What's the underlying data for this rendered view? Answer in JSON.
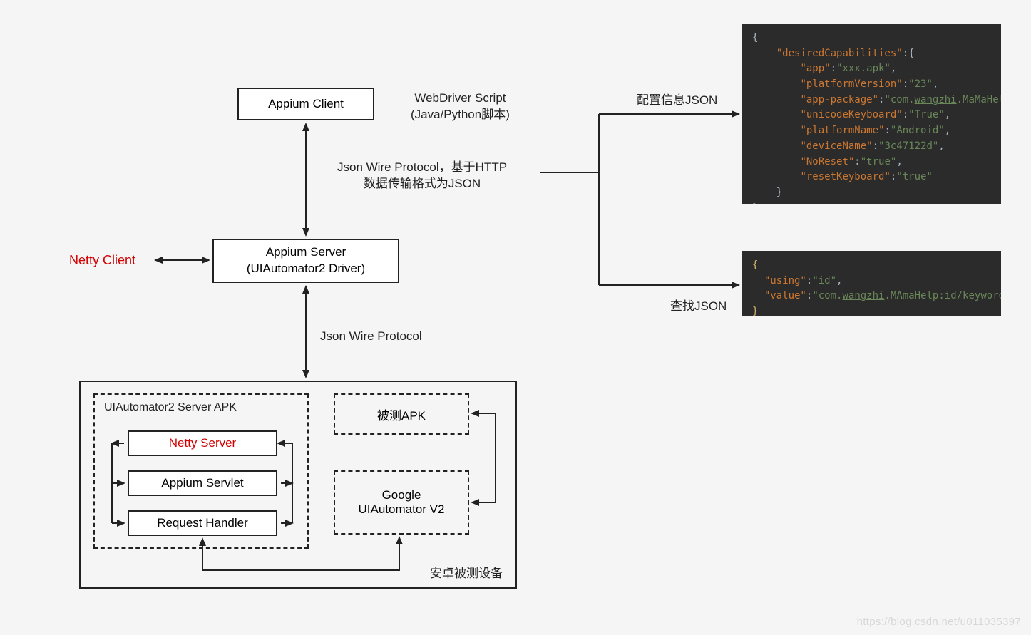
{
  "boxes": {
    "appium_client": "Appium Client",
    "appium_server_l1": "Appium Server",
    "appium_server_l2": "(UIAutomator2 Driver)",
    "netty_client": "Netty Client",
    "uia2_server_title": "UIAutomator2 Server APK",
    "netty_server": "Netty Server",
    "appium_servlet": "Appium Servlet",
    "request_handler": "Request Handler",
    "tested_apk": "被测APK",
    "google_uia2_l1": "Google",
    "google_uia2_l2": "UIAutomator V2",
    "device_label": "安卓被测设备"
  },
  "labels": {
    "webdriver_l1": "WebDriver Script",
    "webdriver_l2": "(Java/Python脚本)",
    "jsonwire_l1": "Json Wire Protocol，基于HTTP",
    "jsonwire_l2": "数据传输格式为JSON",
    "jsonwire_single": "Json Wire Protocol",
    "config_json": "配置信息JSON",
    "search_json": "查找JSON"
  },
  "code1": {
    "brace_open": "{",
    "k1": "\"desiredCapabilities\"",
    "v1_brace": ":{",
    "kv": [
      [
        "\"app\"",
        "\"xxx.apk\""
      ],
      [
        "\"platformVersion\"",
        "\"23\""
      ],
      [
        "\"app-package\"",
        "\"com.",
        "wangzhi",
        ".MaMaHelp\""
      ],
      [
        "\"unicodeKeyboard\"",
        "\"True\""
      ],
      [
        "\"platformName\"",
        "\"Android\""
      ],
      [
        "\"deviceName\"",
        "\"3c47122d\""
      ],
      [
        "\"NoReset\"",
        "\"true\""
      ],
      [
        "\"resetKeyboard\"",
        "\"true\""
      ]
    ],
    "inner_close": "}",
    "brace_close": "}"
  },
  "code2": {
    "brace_open": "{",
    "using_k": "\"using\"",
    "using_v": "\"id\"",
    "value_k": "\"value\"",
    "value_v_pre": "\"com.",
    "value_v_mid": "wangzhi",
    "value_v_post": ".MAmaHelp:id/keyword\"",
    "brace_close": "}"
  },
  "watermark": "https://blog.csdn.net/u011035397"
}
